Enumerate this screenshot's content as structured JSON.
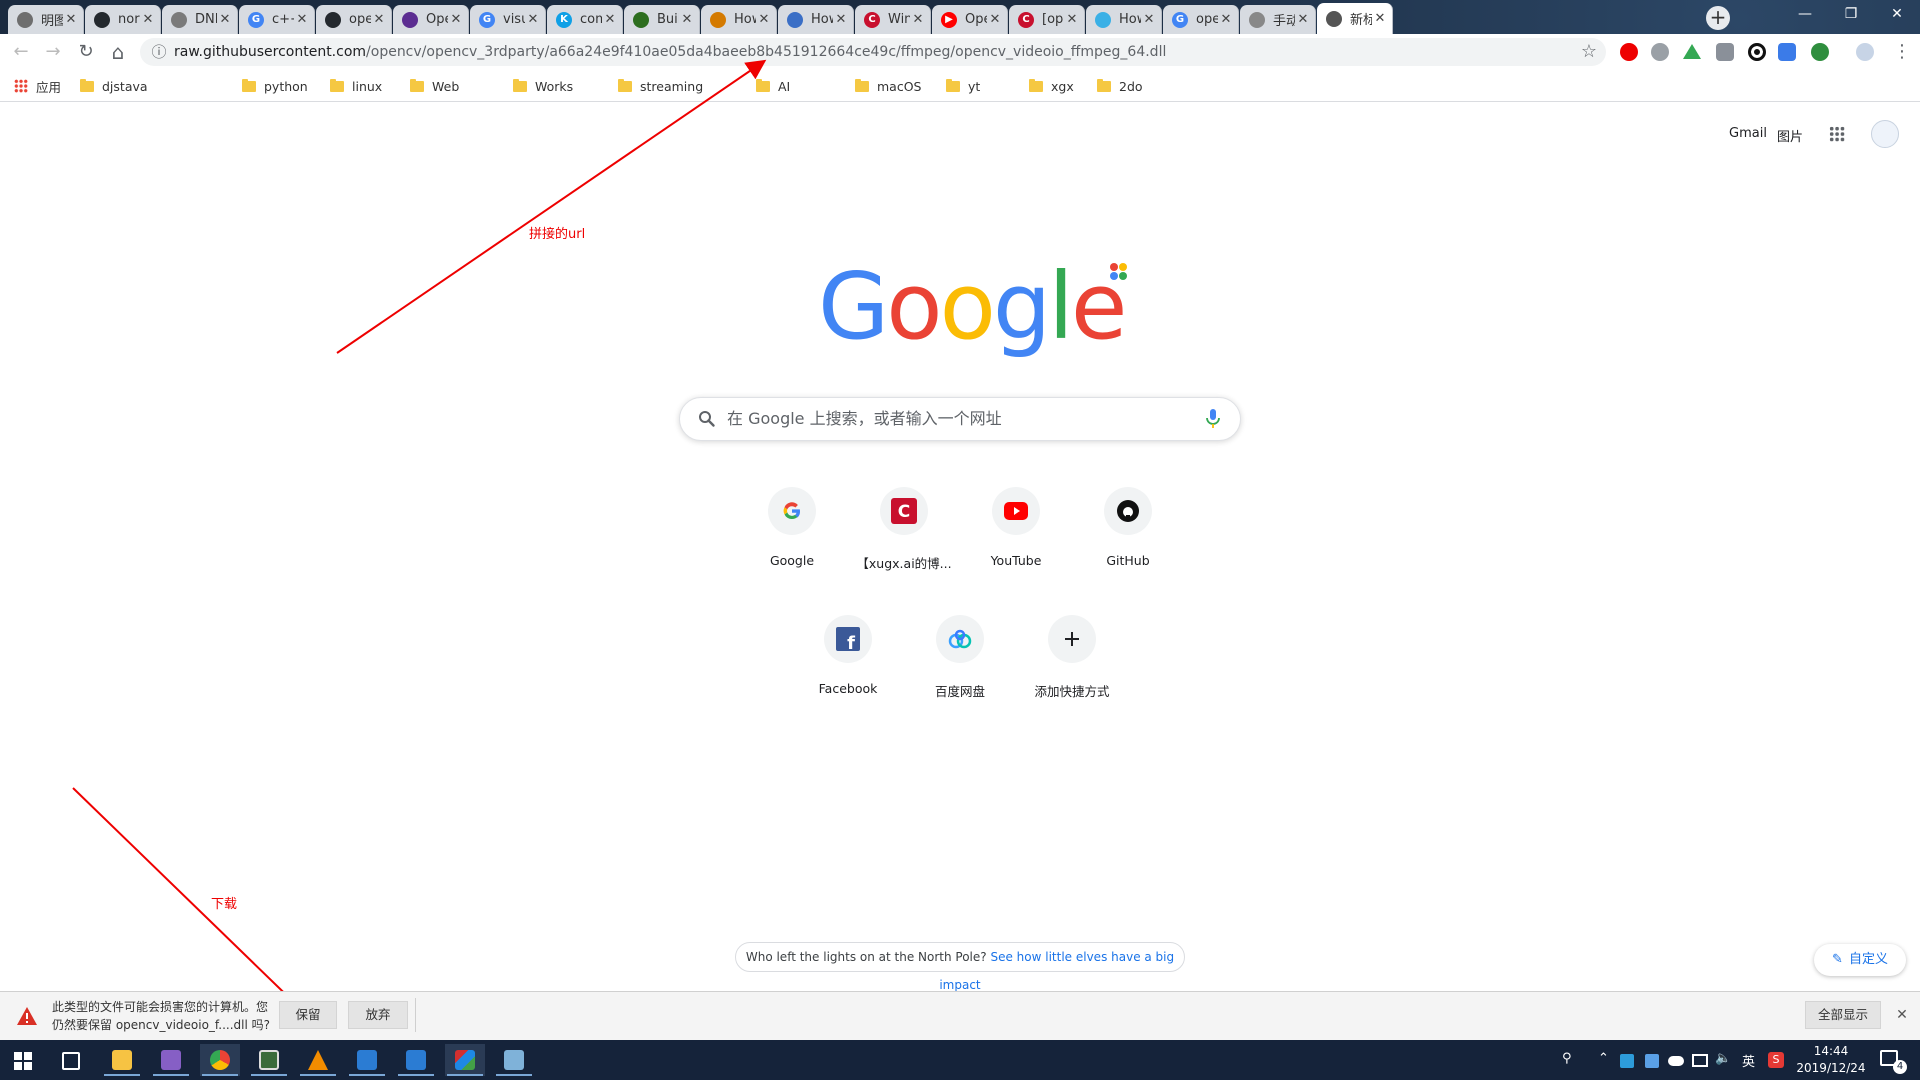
{
  "tabs": [
    {
      "title": "明图",
      "fav_color": "#6e6e6e",
      "glyph": ""
    },
    {
      "title": "norm",
      "fav_color": "#24292e",
      "glyph": ""
    },
    {
      "title": "DNN",
      "fav_color": "#7a7a7a",
      "glyph": ""
    },
    {
      "title": "c++",
      "fav_color": "#4285f4",
      "glyph": "G"
    },
    {
      "title": "open",
      "fav_color": "#24292e",
      "glyph": ""
    },
    {
      "title": "Oper",
      "fav_color": "#5c2d91",
      "glyph": ""
    },
    {
      "title": "visua",
      "fav_color": "#4285f4",
      "glyph": "G"
    },
    {
      "title": "comp",
      "fav_color": "#0fa0e6",
      "glyph": "K"
    },
    {
      "title": "Build",
      "fav_color": "#2d6e1f",
      "glyph": ""
    },
    {
      "title": "How",
      "fav_color": "#d47a00",
      "glyph": ""
    },
    {
      "title": "How",
      "fav_color": "#3b6fc6",
      "glyph": ""
    },
    {
      "title": "Winc",
      "fav_color": "#c8102e",
      "glyph": "C"
    },
    {
      "title": "Oper",
      "fav_color": "#ff0000",
      "glyph": "▶"
    },
    {
      "title": "[op",
      "fav_color": "#c8102e",
      "glyph": "C"
    },
    {
      "title": "How",
      "fav_color": "#3ab0e6",
      "glyph": ""
    },
    {
      "title": "oper",
      "fav_color": "#4285f4",
      "glyph": "G"
    },
    {
      "title": "手动",
      "fav_color": "#888888",
      "glyph": ""
    },
    {
      "title": "新标",
      "fav_color": "#555555",
      "glyph": "",
      "active": true
    }
  ],
  "tab_close": "✕",
  "new_tab": "+",
  "window": {
    "min": "—",
    "max": "❐",
    "close": "✕"
  },
  "toolbar": {
    "back": "←",
    "forward": "→",
    "reload": "↻",
    "home": "⌂",
    "info": "ⓘ",
    "star": "☆",
    "menu": "⋮",
    "url_host": "raw.githubusercontent.com",
    "url_path": "/opencv/opencv_3rdparty/a66a24e9f410ae05da4baeeb8b451912664ce49c/ffmpeg/opencv_videoio_ffmpeg_64.dll"
  },
  "bookmarks": {
    "apps": "应用",
    "items": [
      "djstava",
      "python",
      "linux",
      "Web",
      "Works",
      "streaming",
      "AI",
      "macOS",
      "yt",
      "xgx",
      "2do"
    ]
  },
  "top_links": {
    "gmail": "Gmail",
    "images": "图片"
  },
  "logo_text": "Google",
  "colors": {
    "blue": "#4285f4",
    "red": "#ea4335",
    "yellow": "#fbbc05",
    "green": "#34a853",
    "annotation": "#ee0000"
  },
  "search": {
    "placeholder": "在 Google 上搜索，或者输入一个网址"
  },
  "shortcuts": [
    {
      "label": "Google",
      "icon": "google-icon"
    },
    {
      "label": "【xugx.ai的博...",
      "icon": "csdn-icon"
    },
    {
      "label": "YouTube",
      "icon": "youtube-icon"
    },
    {
      "label": "GitHub",
      "icon": "github-icon"
    },
    {
      "label": "Facebook",
      "icon": "facebook-icon"
    },
    {
      "label": "百度网盘",
      "icon": "baidu-pan-icon"
    },
    {
      "label": "添加快捷方式",
      "icon": "plus-icon"
    }
  ],
  "promo": {
    "text": "Who left the lights on at the North Pole?",
    "link": "See how little elves have a big impact"
  },
  "customize": "自定义",
  "annotations": {
    "url": "拼接的url",
    "download": "下载"
  },
  "download_bar": {
    "warning": "此类型的文件可能会损害您的计算机。您仍然要保留 opencv_videoio_f....dll 吗?",
    "keep": "保留",
    "discard": "放弃",
    "show_all": "全部显示",
    "close": "✕"
  },
  "taskbar": {
    "time": "14:44",
    "date": "2019/12/24",
    "ime": "英",
    "notifications": "4"
  }
}
